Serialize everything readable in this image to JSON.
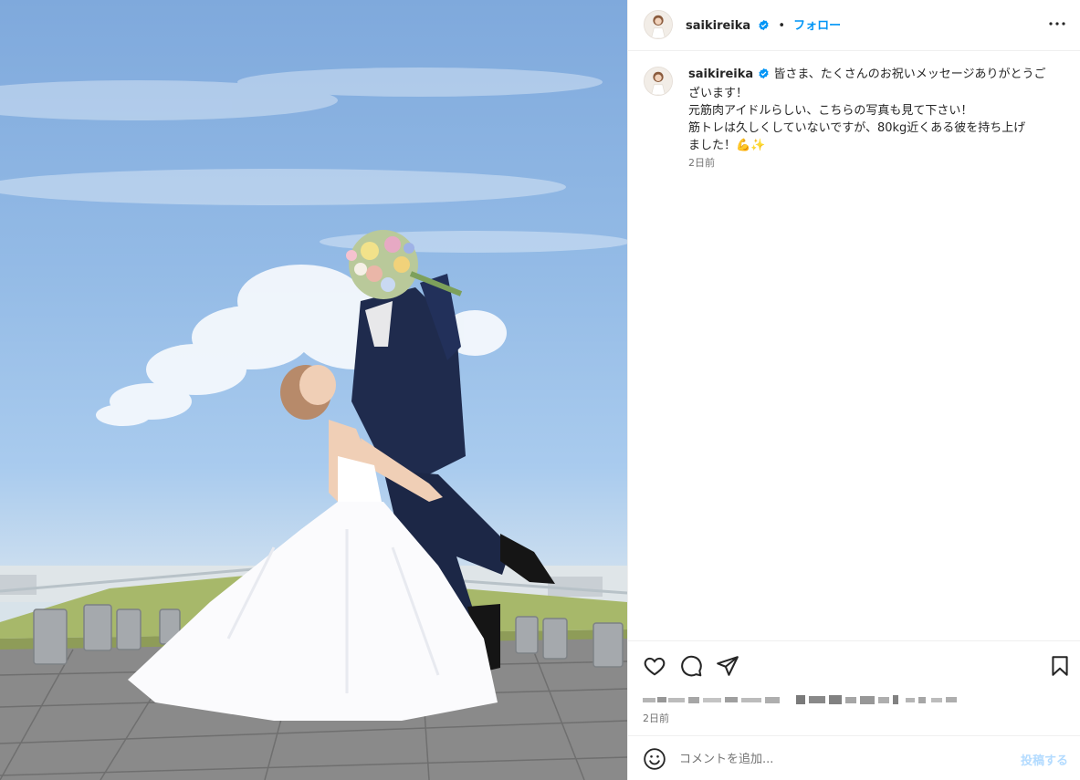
{
  "header": {
    "username": "saikireika",
    "separator": "•",
    "follow_label": "フォロー",
    "more_icon": "more-horizontal-icon"
  },
  "caption": {
    "username": "saikireika",
    "lines": [
      "皆さま、たくさんのお祝いメッセージありがとうご",
      "ざいます！",
      "元筋肉アイドルらしい、こちらの写真も見て下さい！",
      "筋トレは久しくしていないですが、80kg近くある彼を持ち上げ",
      "ました！💪✨"
    ],
    "time": "2日前"
  },
  "actions": {
    "icons": [
      "heart-icon",
      "comment-icon",
      "share-icon",
      "bookmark-icon"
    ]
  },
  "post_time": "2日前",
  "comment": {
    "placeholder": "コメントを追加...",
    "post_label": "投稿する"
  },
  "colors": {
    "accent": "#0095f6",
    "verified": "#0095f6",
    "post_disabled": "#b3dbff",
    "sky": "#94bbe6"
  }
}
